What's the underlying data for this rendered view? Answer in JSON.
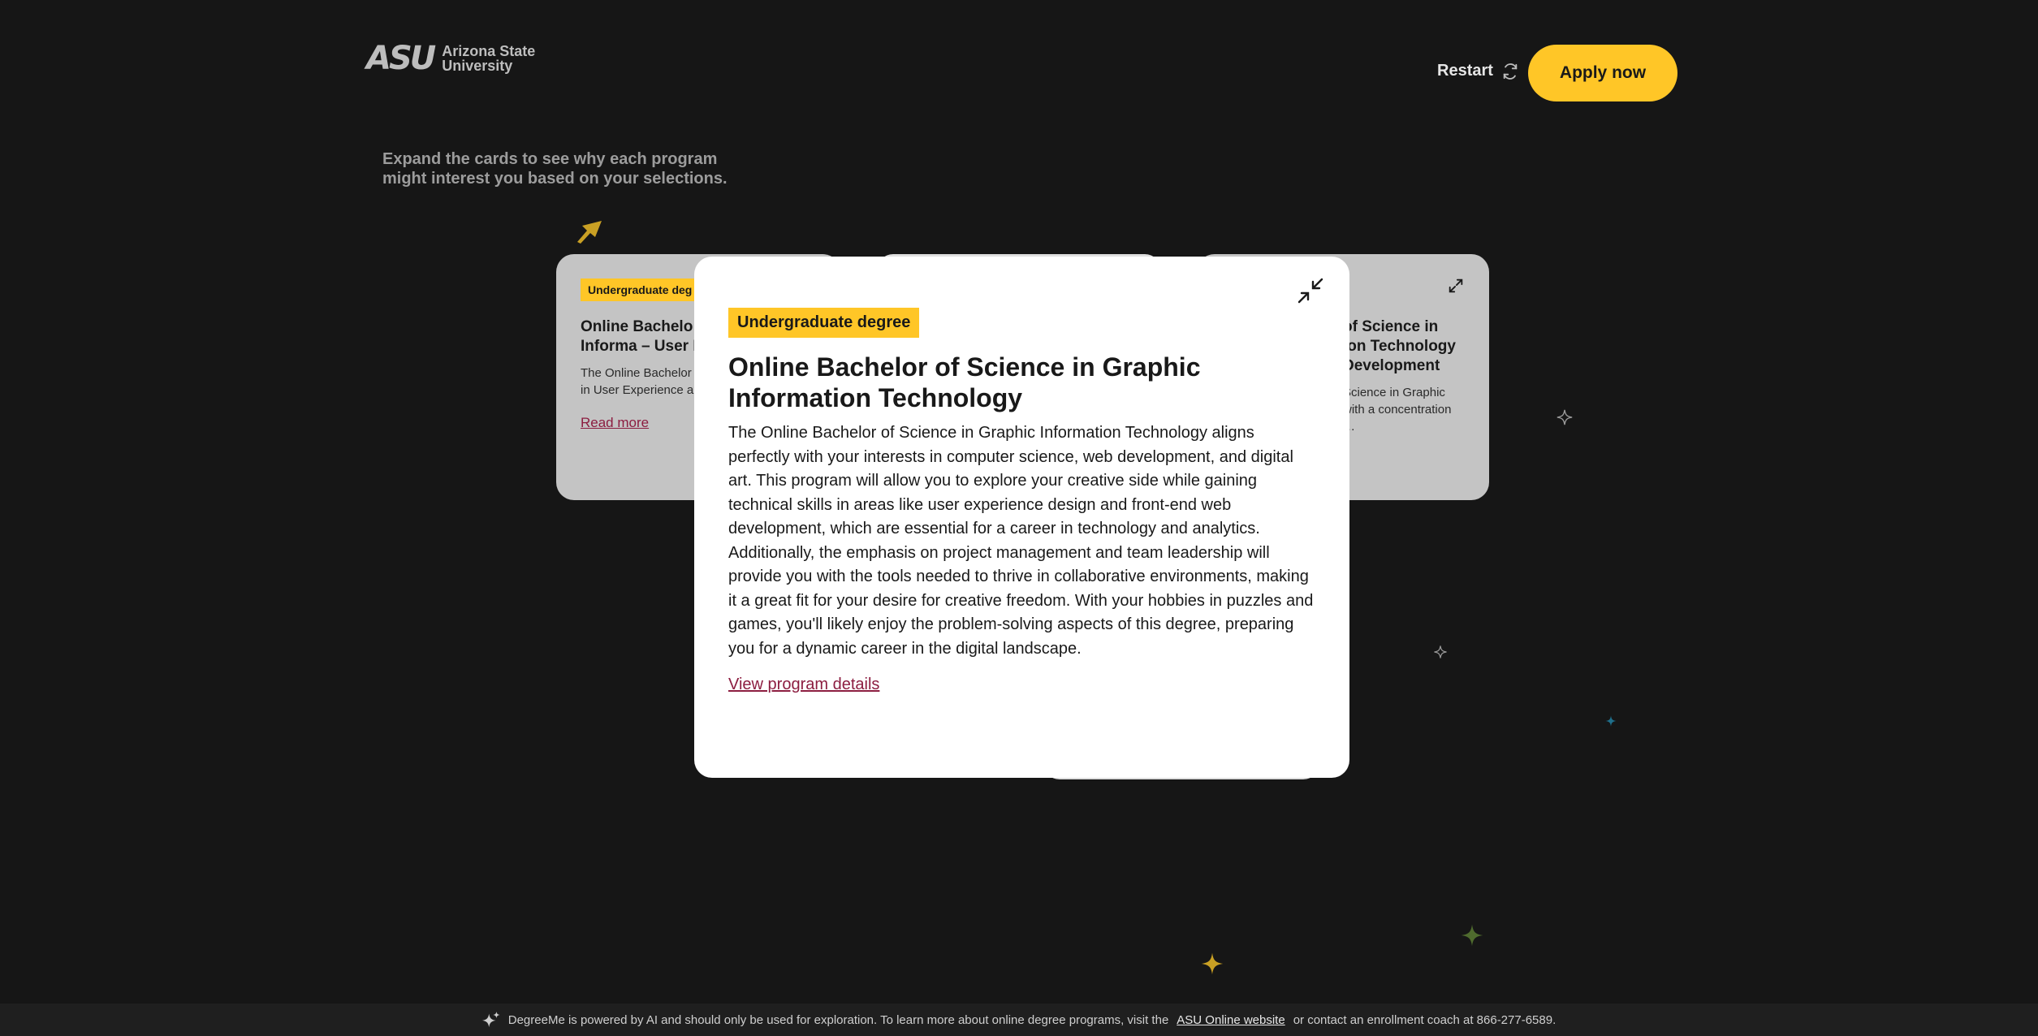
{
  "header": {
    "logo_mark": "ASU",
    "logo_name_line1": "Arizona State",
    "logo_name_line2": "University",
    "restart_label": "Restart",
    "apply_label": "Apply now"
  },
  "intro_text": "Expand the cards to see why each program might interest you based on your selections.",
  "cards": {
    "left": {
      "badge": "Undergraduate deg",
      "title": "Online Bachelo Graphic Informa – User Experien",
      "excerpt": "The Online Bachelor Information Technolo in User Experience a",
      "link": "Read more"
    },
    "right": {
      "badge": "e",
      "title": "of Science in ion Technology Development",
      "excerpt": "Science in Graphic with a concentration …"
    }
  },
  "modal": {
    "badge": "Undergraduate degree",
    "title": "Online Bachelor of Science in Graphic Information Technology",
    "body": "The Online Bachelor of Science in Graphic Information Technology aligns perfectly with your interests in computer science, web development, and digital art. This program will allow you to explore your creative side while gaining technical skills in areas like user experience design and front-end web development, which are essential for a career in technology and analytics. Additionally, the emphasis on project management and team leadership will provide you with the tools needed to thrive in collaborative environments, making it a great fit for your desire for creative freedom. With your hobbies in puzzles and games, you'll likely enjoy the problem-solving aspects of this degree, preparing you for a dynamic career in the digital landscape.",
    "link": "View program details"
  },
  "footer": {
    "text_before": "DegreeMe is powered by AI and should only be used for exploration. To learn more about online degree programs, visit the",
    "link": "ASU Online website",
    "text_after": "or contact an enrollment coach at 866-277-6589."
  },
  "colors": {
    "background": "#161616",
    "gold": "#ffc627",
    "maroon": "#8c1d40",
    "card_gray": "#c4c4c4"
  },
  "icons": [
    "refresh-icon",
    "arrow-pointer-icon",
    "expand-icon",
    "collapse-icon",
    "sparkle-icon",
    "ai-sparkle-icon"
  ]
}
